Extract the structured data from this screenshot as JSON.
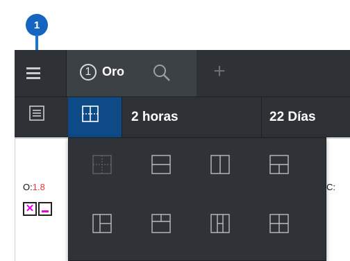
{
  "step_marker": {
    "number": "1"
  },
  "tabbar": {
    "tab": {
      "number": "1",
      "label": "Oro"
    },
    "add_tab_label": "+"
  },
  "toolbar": {
    "interval": "2 horas",
    "range": "22 Días"
  },
  "chart": {
    "open_label": "O:",
    "open_value": "1.8",
    "close_label": "C:"
  },
  "layout_menu": {
    "options": [
      "layout-single-icon",
      "layout-horizontal-split-icon",
      "layout-vertical-split-icon",
      "layout-top-two-bottom-one-icon",
      "layout-left-one-right-two-icon",
      "layout-top-one-bottom-two-icon",
      "layout-three-columns-icon",
      "layout-grid-four-icon"
    ]
  },
  "colors": {
    "toolbar_bg": "#2e3236",
    "active_tab_bg": "#3c4146",
    "selected_button_bg": "#0d4a86",
    "marker_bg": "#1565c0",
    "price_value": "#e53935",
    "accent_magenta": "#e600e6"
  }
}
